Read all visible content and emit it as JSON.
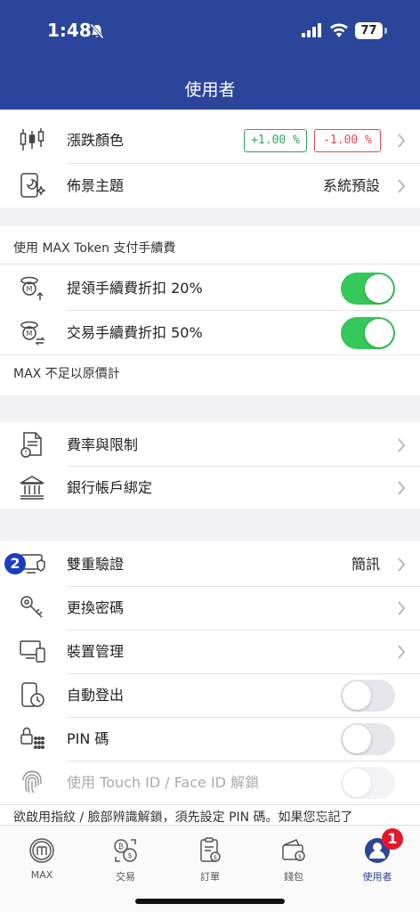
{
  "status": {
    "time": "1:48",
    "battery": "77"
  },
  "header": {
    "title": "使用者"
  },
  "display": {
    "price_color_label": "漲跌顏色",
    "up_sample": "+1.00 %",
    "down_sample": "-1.00 %",
    "theme_label": "佈景主題",
    "theme_value": "系統預設"
  },
  "max_token": {
    "section_title": "使用 MAX Token 支付手續費",
    "withdraw_label": "提領手續費折扣 20%",
    "withdraw_enabled": true,
    "trade_label": "交易手續費折扣 50%",
    "trade_enabled": true,
    "footnote": "MAX 不足以原價計"
  },
  "account": {
    "fees_label": "費率與限制",
    "bank_label": "銀行帳戶綁定"
  },
  "security": {
    "two_factor_label": "雙重驗證",
    "two_factor_value": "簡訊",
    "password_label": "更換密碼",
    "devices_label": "裝置管理",
    "auto_logout_label": "自動登出",
    "auto_logout_enabled": false,
    "pin_label": "PIN 碼",
    "pin_enabled": false,
    "biometric_label": "使用 Touch ID / Face ID 解鎖",
    "biometric_enabled": false,
    "biometric_note": "欲啟用指紋 / 臉部辨識解鎖，須先設定 PIN 碼。如果您忘記了"
  },
  "annotations": {
    "marker_1": "1",
    "marker_2": "2"
  },
  "tabs": [
    {
      "label": "MAX",
      "icon": "max-logo-icon"
    },
    {
      "label": "交易",
      "icon": "exchange-icon"
    },
    {
      "label": "訂單",
      "icon": "orders-icon"
    },
    {
      "label": "錢包",
      "icon": "wallet-icon"
    },
    {
      "label": "使用者",
      "icon": "user-icon"
    }
  ],
  "colors": {
    "header": "#2a4599",
    "toggle_on": "#34c759",
    "up": "#2ea55a",
    "down": "#e2484d"
  }
}
